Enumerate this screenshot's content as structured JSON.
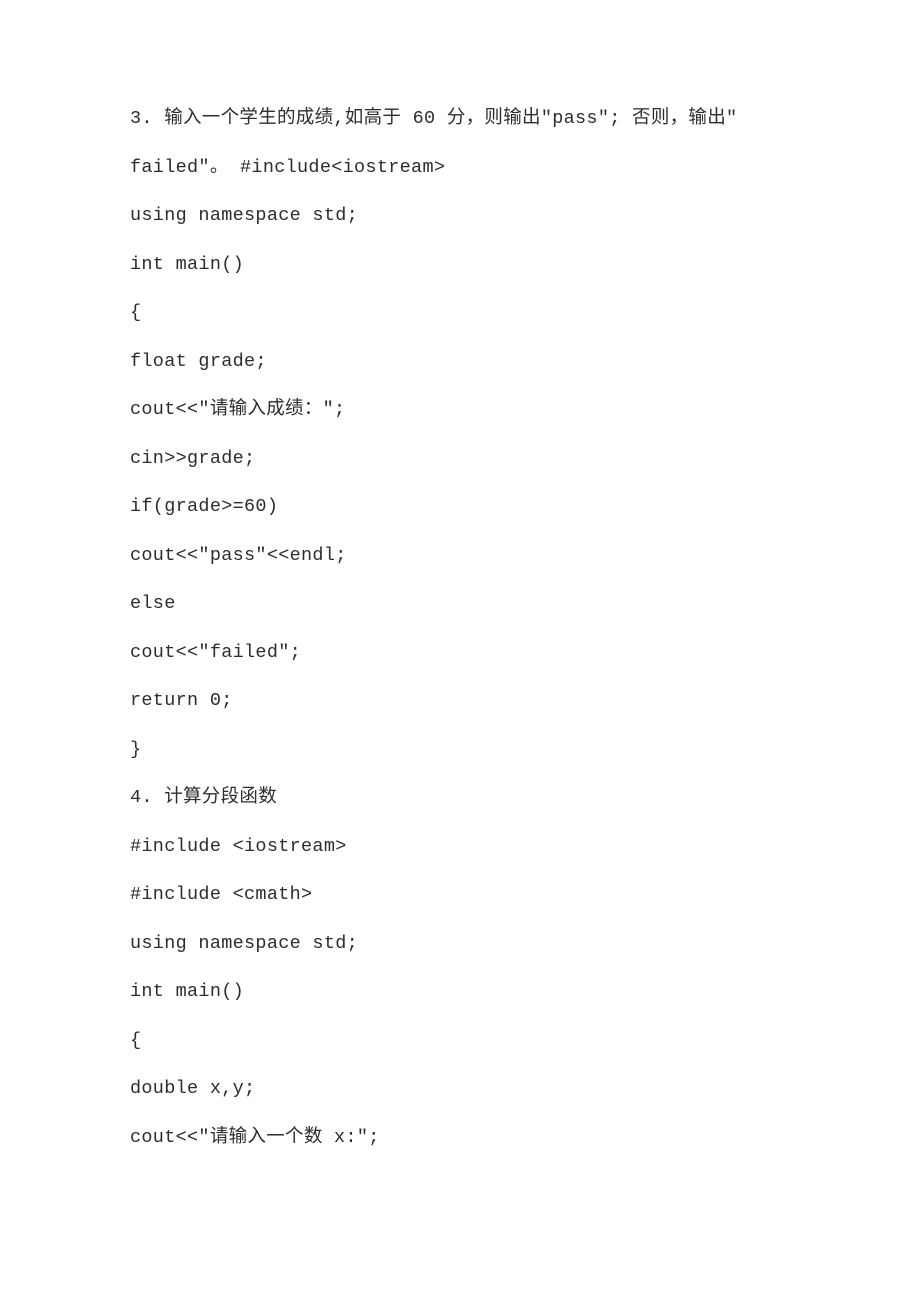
{
  "lines": [
    "3. 输入一个学生的成绩,如高于 60 分，则输出\"pass\"; 否则，输出\"",
    "failed\"。 #include<iostream>",
    "using namespace std;",
    "int main()",
    "{",
    "float grade;",
    "cout<<\"请输入成绩：\";",
    "cin>>grade;",
    "if(grade>=60)",
    "cout<<\"pass\"<<endl;",
    "else",
    "cout<<\"failed\";",
    "return 0;",
    "}",
    "4. 计算分段函数",
    "#include <iostream>",
    "#include <cmath>",
    "using namespace std;",
    "int main()",
    "{",
    "double x,y;",
    "cout<<\"请输入一个数 x:\";"
  ]
}
